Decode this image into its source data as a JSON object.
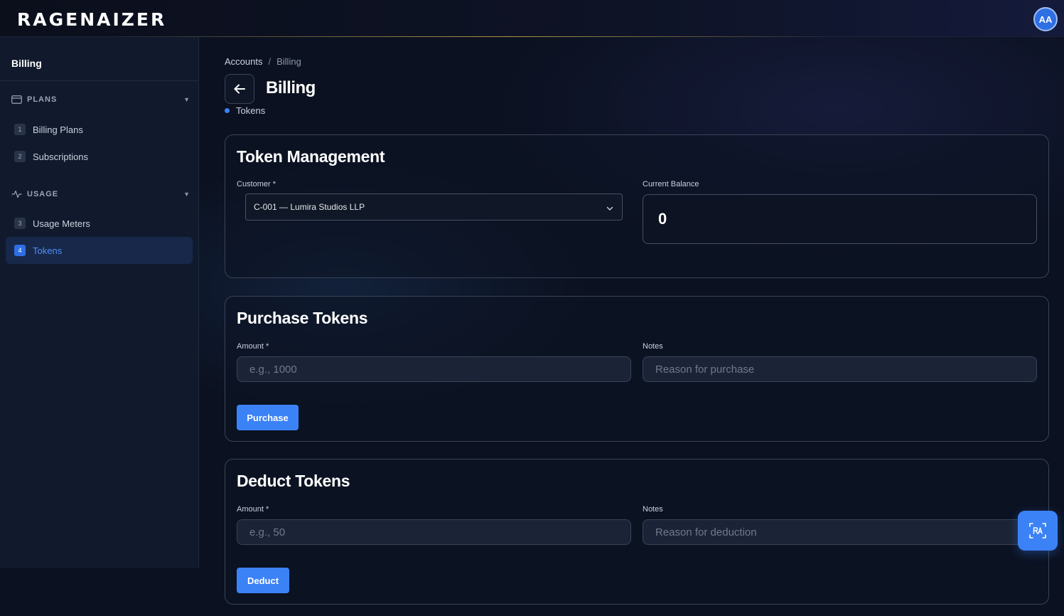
{
  "brand": {
    "logo_text": "RAGENAIZER"
  },
  "user": {
    "initials": "AA"
  },
  "sidebar": {
    "title": "Billing",
    "groups": [
      {
        "label": "PLANS",
        "icon": "credit-card-icon",
        "items": [
          {
            "num": "1",
            "label": "Billing Plans"
          },
          {
            "num": "2",
            "label": "Subscriptions"
          }
        ]
      },
      {
        "label": "USAGE",
        "icon": "activity-icon",
        "items": [
          {
            "num": "3",
            "label": "Usage Meters"
          },
          {
            "num": "4",
            "label": "Tokens",
            "active": true
          }
        ]
      }
    ]
  },
  "breadcrumb": {
    "parent": "Accounts",
    "separator": "/",
    "current": "Billing"
  },
  "page": {
    "title": "Billing",
    "section": "Tokens"
  },
  "token_management": {
    "title": "Token Management",
    "customer_label": "Customer *",
    "customer_value": "C-001 — Lumira Studios LLP",
    "balance_label": "Current Balance",
    "balance_value": "0"
  },
  "purchase": {
    "title": "Purchase Tokens",
    "amount_label": "Amount *",
    "amount_placeholder": "e.g., 1000",
    "notes_label": "Notes",
    "notes_placeholder": "Reason for purchase",
    "button_label": "Purchase"
  },
  "deduct": {
    "title": "Deduct Tokens",
    "amount_label": "Amount *",
    "amount_placeholder": "e.g., 50",
    "notes_label": "Notes",
    "notes_placeholder": "Reason for deduction",
    "button_label": "Deduct"
  },
  "colors": {
    "accent": "#3b82f6",
    "background": "#0b1120",
    "sidebar": "#111a2d"
  }
}
